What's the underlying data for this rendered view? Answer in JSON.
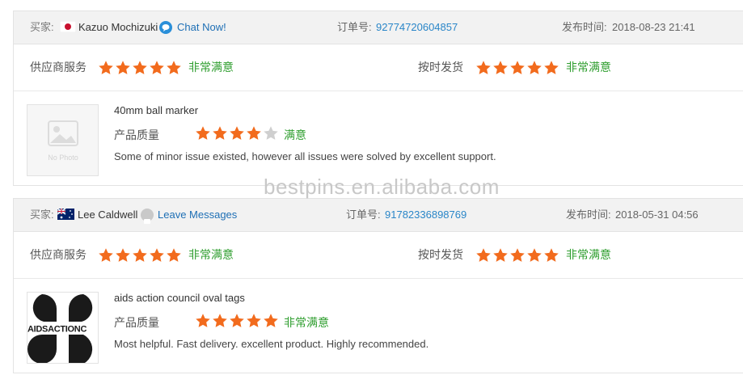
{
  "reviews": [
    {
      "buyer_label": "买家:",
      "buyer_name": "Kazuo Mochizuki",
      "flag": "japan-flag",
      "action_icon": "chat-bubble-icon",
      "action_label": "Chat Now!",
      "order_label": "订单号:",
      "order_number": "92774720604857",
      "date_label": "发布时间:",
      "date": "2018-08-23 21:41",
      "supplier_service": {
        "label": "供应商服务",
        "rating": 5,
        "verdict": "非常满意"
      },
      "on_time_delivery": {
        "label": "按时发货",
        "rating": 5,
        "verdict": "非常满意"
      },
      "item": {
        "title": "40mm ball marker",
        "quality_label": "产品质量",
        "quality_rating": 4,
        "quality_verdict": "满意",
        "comment": "Some of minor issue existed, however all issues were solved by excellent support.",
        "thumbnail_text": "No Photo"
      }
    },
    {
      "buyer_label": "买家:",
      "buyer_name": "Lee Caldwell",
      "flag": "australia-flag",
      "action_icon": "message-icon",
      "action_label": "Leave Messages",
      "order_label": "订单号:",
      "order_number": "91782336898769",
      "date_label": "发布时间:",
      "date": "2018-05-31 04:56",
      "supplier_service": {
        "label": "供应商服务",
        "rating": 5,
        "verdict": "非常满意"
      },
      "on_time_delivery": {
        "label": "按时发货",
        "rating": 5,
        "verdict": "非常满意"
      },
      "item": {
        "title": "aids action council oval tags",
        "quality_label": "产品质量",
        "quality_rating": 5,
        "quality_verdict": "非常满意",
        "comment": "Most helpful. Fast delivery. excellent product. Highly recommended.",
        "thumbnail_text": "AIDSACTIONC"
      }
    }
  ],
  "watermark": "bestpins.en.alibaba.com",
  "colors": {
    "star_active": "#f26b1d",
    "star_inactive": "#cfcfcf",
    "verdict": "#2f9e2f",
    "link": "#1e6fb5"
  }
}
